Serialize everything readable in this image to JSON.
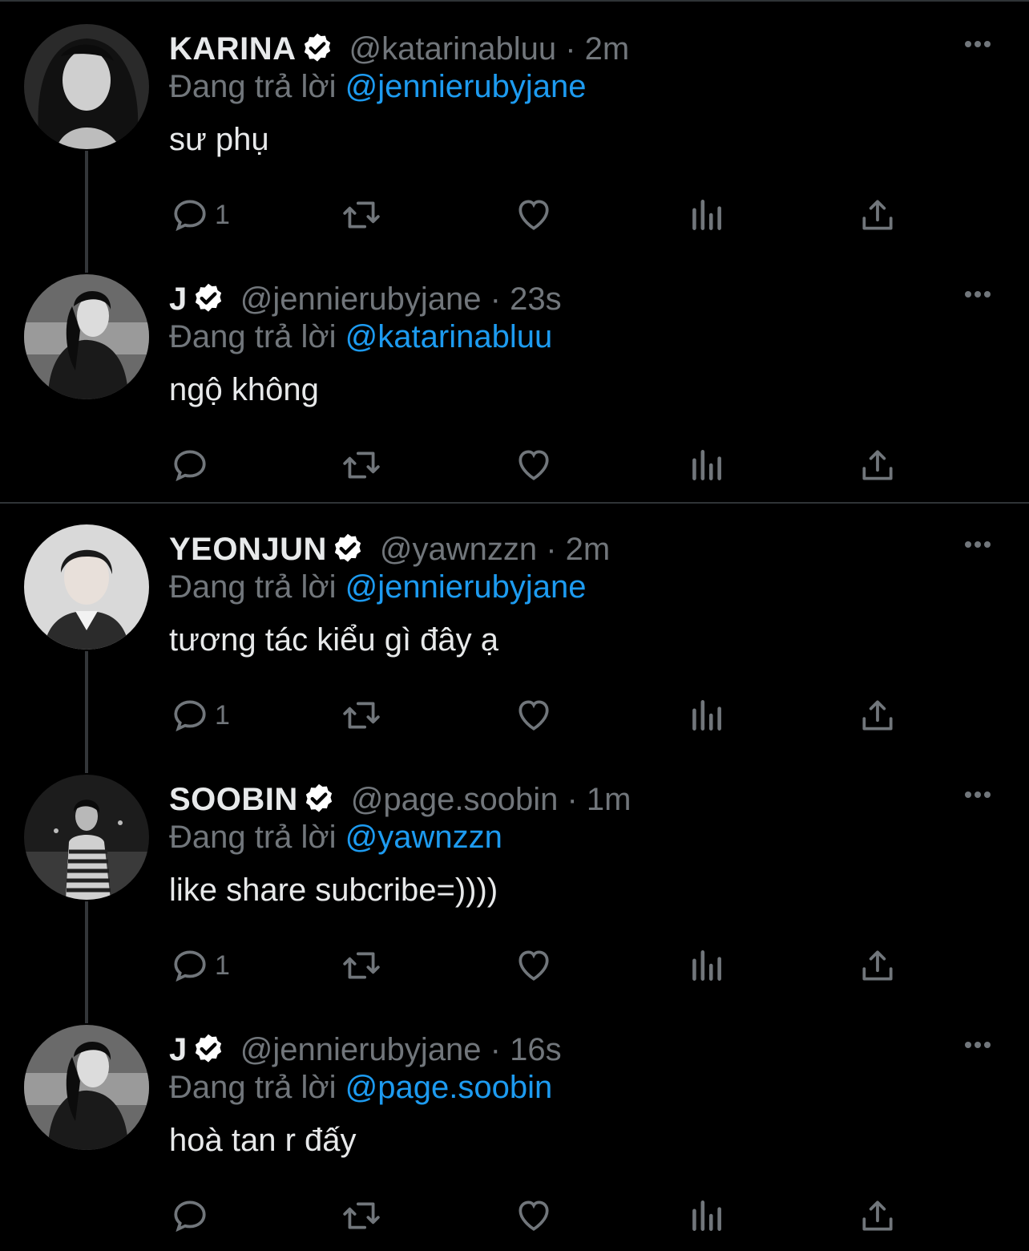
{
  "theme": {
    "background": "#000000",
    "text": "#e7e9ea",
    "muted": "#71767b",
    "link": "#1d9bf0",
    "separator": "#2f3336"
  },
  "reply_prefix": "Đang trả lời",
  "threads": [
    {
      "tweets": [
        {
          "name": "KARINA",
          "handle": "@katarinabluu",
          "time": "2m",
          "meta": "@katarinabluu · 2m",
          "reply_to": "@jennierubyjane",
          "text": "sư phụ",
          "reply_count": "1",
          "avatar": "karina-avatar"
        },
        {
          "name": "J",
          "handle": "@jennierubyjane",
          "time": "23s",
          "meta": "@jennierubyjane · 23s",
          "reply_to": "@katarinabluu",
          "text": "ngộ không",
          "reply_count": "",
          "avatar": "jennie-avatar"
        }
      ]
    },
    {
      "tweets": [
        {
          "name": "YEONJUN",
          "handle": "@yawnzzn",
          "time": "2m",
          "meta": "@yawnzzn · 2m",
          "reply_to": "@jennierubyjane",
          "text": "tương tác kiểu gì đây ạ",
          "reply_count": "1",
          "avatar": "yeonjun-avatar"
        },
        {
          "name": "SOOBIN",
          "handle": "@page.soobin",
          "time": "1m",
          "meta": "@page.soobin · 1m",
          "reply_to": "@yawnzzn",
          "text": "like share subcribe=))))",
          "reply_count": "1",
          "avatar": "soobin-avatar"
        },
        {
          "name": "J",
          "handle": "@jennierubyjane",
          "time": "16s",
          "meta": "@jennierubyjane · 16s",
          "reply_to": "@page.soobin",
          "text": "hoà tan r đấy",
          "reply_count": "",
          "avatar": "jennie-avatar"
        }
      ]
    }
  ],
  "icons": {
    "verified": "verified-badge-icon",
    "more": "more-options-icon",
    "reply": "reply-icon",
    "retweet": "retweet-icon",
    "like": "like-icon",
    "views": "views-icon",
    "share": "share-icon"
  }
}
